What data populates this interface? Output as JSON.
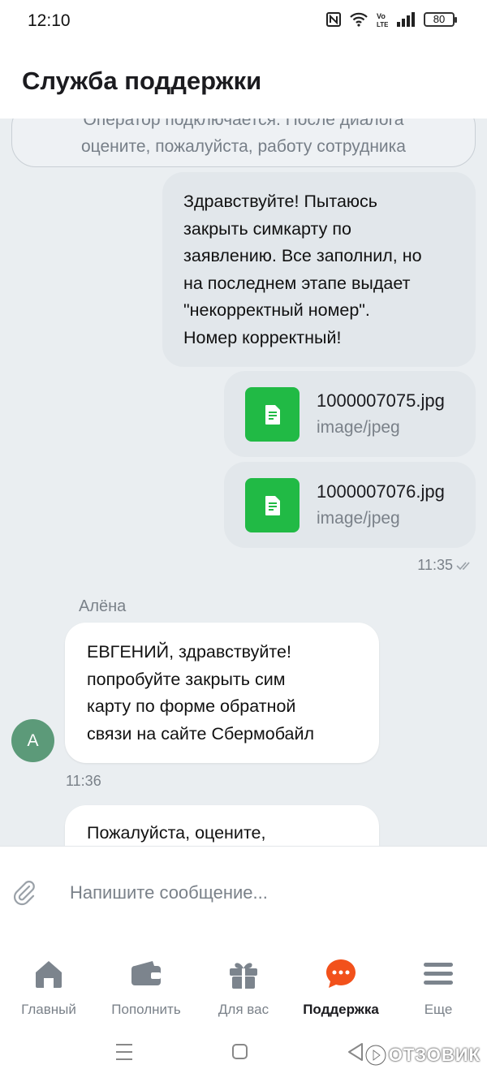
{
  "status": {
    "time": "12:10",
    "battery": "80"
  },
  "header": {
    "title": "Служба поддержки"
  },
  "chat": {
    "system_message": "Оператор подключается. После диалога\nоцените, пожалуйста, работу сотрудника",
    "outgoing_text": "Здравствуйте! Пытаюсь\nзакрыть симкарту по\nзаявлению. Все заполнил, но\nна последнем этапе выдает\n\"некорректный номер\".\nНомер корректный!",
    "files": [
      {
        "name": "1000007075.jpg",
        "type": "image/jpeg",
        "icon": "document-icon"
      },
      {
        "name": "1000007076.jpg",
        "type": "image/jpeg",
        "icon": "document-icon"
      }
    ],
    "outgoing_time": "11:35",
    "operator_name": "Алёна",
    "operator_initial": "А",
    "incoming_text": "ЕВГЕНИЙ, здравствуйте!\nпопробуйте закрыть сим\nкарту по форме обратной\nсвязи на сайте Сбермобайл",
    "incoming_time": "11:36",
    "incoming_text_2": "Пожалуйста, оцените,"
  },
  "composer": {
    "placeholder": "Напишите сообщение..."
  },
  "tabs": [
    {
      "label": "Главный",
      "icon": "home-icon"
    },
    {
      "label": "Пополнить",
      "icon": "wallet-icon"
    },
    {
      "label": "Для вас",
      "icon": "gift-icon"
    },
    {
      "label": "Поддержка",
      "icon": "chat-bubble-icon",
      "active": true
    },
    {
      "label": "Еще",
      "icon": "menu-icon"
    }
  ],
  "watermark": "ОТЗОВИК",
  "colors": {
    "accent_green": "#21ba45",
    "support_orange": "#f2511b",
    "avatar": "#5c9a79",
    "chat_bg": "#eaeef1"
  }
}
